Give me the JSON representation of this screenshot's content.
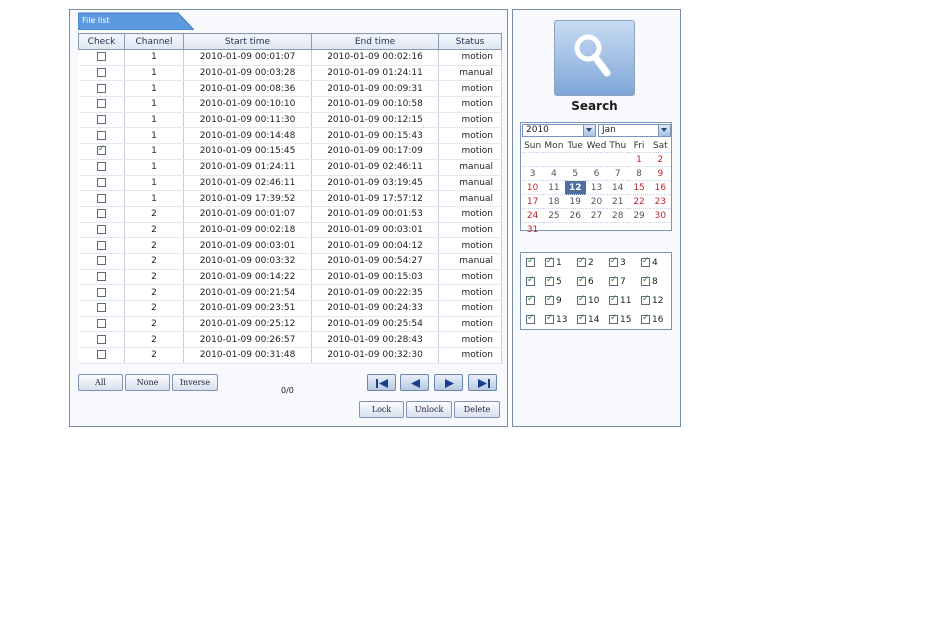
{
  "file_list": {
    "tab_label": "File list",
    "columns": [
      "Check",
      "Channel",
      "Start time",
      "End time",
      "Status"
    ],
    "rows": [
      {
        "checked": false,
        "channel": "1",
        "start": "2010-01-09 00:01:07",
        "end": "2010-01-09 00:02:16",
        "status": "motion"
      },
      {
        "checked": false,
        "channel": "1",
        "start": "2010-01-09 00:03:28",
        "end": "2010-01-09 01:24:11",
        "status": "manual"
      },
      {
        "checked": false,
        "channel": "1",
        "start": "2010-01-09 00:08:36",
        "end": "2010-01-09 00:09:31",
        "status": "motion"
      },
      {
        "checked": false,
        "channel": "1",
        "start": "2010-01-09 00:10:10",
        "end": "2010-01-09 00:10:58",
        "status": "motion"
      },
      {
        "checked": false,
        "channel": "1",
        "start": "2010-01-09 00:11:30",
        "end": "2010-01-09 00:12:15",
        "status": "motion"
      },
      {
        "checked": false,
        "channel": "1",
        "start": "2010-01-09 00:14:48",
        "end": "2010-01-09 00:15:43",
        "status": "motion"
      },
      {
        "checked": true,
        "channel": "1",
        "start": "2010-01-09 00:15:45",
        "end": "2010-01-09 00:17:09",
        "status": "motion"
      },
      {
        "checked": false,
        "channel": "1",
        "start": "2010-01-09 01:24:11",
        "end": "2010-01-09 02:46:11",
        "status": "manual"
      },
      {
        "checked": false,
        "channel": "1",
        "start": "2010-01-09 02:46:11",
        "end": "2010-01-09 03:19:45",
        "status": "manual"
      },
      {
        "checked": false,
        "channel": "1",
        "start": "2010-01-09 17:39:52",
        "end": "2010-01-09 17:57:12",
        "status": "manual"
      },
      {
        "checked": false,
        "channel": "2",
        "start": "2010-01-09 00:01:07",
        "end": "2010-01-09 00:01:53",
        "status": "motion"
      },
      {
        "checked": false,
        "channel": "2",
        "start": "2010-01-09 00:02:18",
        "end": "2010-01-09 00:03:01",
        "status": "motion"
      },
      {
        "checked": false,
        "channel": "2",
        "start": "2010-01-09 00:03:01",
        "end": "2010-01-09 00:04:12",
        "status": "motion"
      },
      {
        "checked": false,
        "channel": "2",
        "start": "2010-01-09 00:03:32",
        "end": "2010-01-09 00:54:27",
        "status": "manual"
      },
      {
        "checked": false,
        "channel": "2",
        "start": "2010-01-09 00:14:22",
        "end": "2010-01-09 00:15:03",
        "status": "motion"
      },
      {
        "checked": false,
        "channel": "2",
        "start": "2010-01-09 00:21:54",
        "end": "2010-01-09 00:22:35",
        "status": "motion"
      },
      {
        "checked": false,
        "channel": "2",
        "start": "2010-01-09 00:23:51",
        "end": "2010-01-09 00:24:33",
        "status": "motion"
      },
      {
        "checked": false,
        "channel": "2",
        "start": "2010-01-09 00:25:12",
        "end": "2010-01-09 00:25:54",
        "status": "motion"
      },
      {
        "checked": false,
        "channel": "2",
        "start": "2010-01-09 00:26:57",
        "end": "2010-01-09 00:28:43",
        "status": "motion"
      },
      {
        "checked": false,
        "channel": "2",
        "start": "2010-01-09 00:31:48",
        "end": "2010-01-09 00:32:30",
        "status": "motion"
      }
    ]
  },
  "selection_buttons": {
    "all": "All",
    "none": "None",
    "inverse": "Inverse"
  },
  "page_indicator": "0/0",
  "nav_buttons": [
    "first-page-icon",
    "prev-page-icon",
    "next-page-icon",
    "last-page-icon"
  ],
  "action_buttons": {
    "lock": "Lock",
    "unlock": "Unlock",
    "delete": "Delete"
  },
  "search": {
    "label": "Search",
    "icon": "magnifier-icon"
  },
  "calendar": {
    "year": "2010",
    "month": "Jan",
    "weekdays": [
      "Sun",
      "Mon",
      "Tue",
      "Wed",
      "Thu",
      "Fri",
      "Sat"
    ],
    "weeks": [
      [
        "",
        "",
        "",
        "",
        "",
        "1",
        "2"
      ],
      [
        "3",
        "4",
        "5",
        "6",
        "7",
        "8",
        "9"
      ],
      [
        "10",
        "11",
        "12",
        "13",
        "14",
        "15",
        "16"
      ],
      [
        "17",
        "18",
        "19",
        "20",
        "21",
        "22",
        "23"
      ],
      [
        "24",
        "25",
        "26",
        "27",
        "28",
        "29",
        "30"
      ],
      [
        "31",
        "",
        "",
        "",
        "",
        "",
        ""
      ]
    ],
    "highlight_days": [
      "1",
      "2",
      "9",
      "10",
      "15",
      "16",
      "17",
      "22",
      "23",
      "24",
      "30",
      "31"
    ],
    "selected_day": "12"
  },
  "channels": [
    {
      "label": "",
      "checked": true
    },
    {
      "label": "1",
      "checked": true
    },
    {
      "label": "2",
      "checked": true
    },
    {
      "label": "3",
      "checked": true
    },
    {
      "label": "4",
      "checked": true
    },
    {
      "label": "",
      "checked": true
    },
    {
      "label": "5",
      "checked": true
    },
    {
      "label": "6",
      "checked": true
    },
    {
      "label": "7",
      "checked": true
    },
    {
      "label": "8",
      "checked": true
    },
    {
      "label": "",
      "checked": true
    },
    {
      "label": "9",
      "checked": true
    },
    {
      "label": "10",
      "checked": true
    },
    {
      "label": "11",
      "checked": true
    },
    {
      "label": "12",
      "checked": true
    },
    {
      "label": "",
      "checked": true
    },
    {
      "label": "13",
      "checked": true
    },
    {
      "label": "14",
      "checked": true
    },
    {
      "label": "15",
      "checked": true
    },
    {
      "label": "16",
      "checked": true
    }
  ],
  "colors": {
    "accent": "#4f8fd6",
    "weekend": "#c0242c",
    "selected_day": "#4f6f9f"
  }
}
